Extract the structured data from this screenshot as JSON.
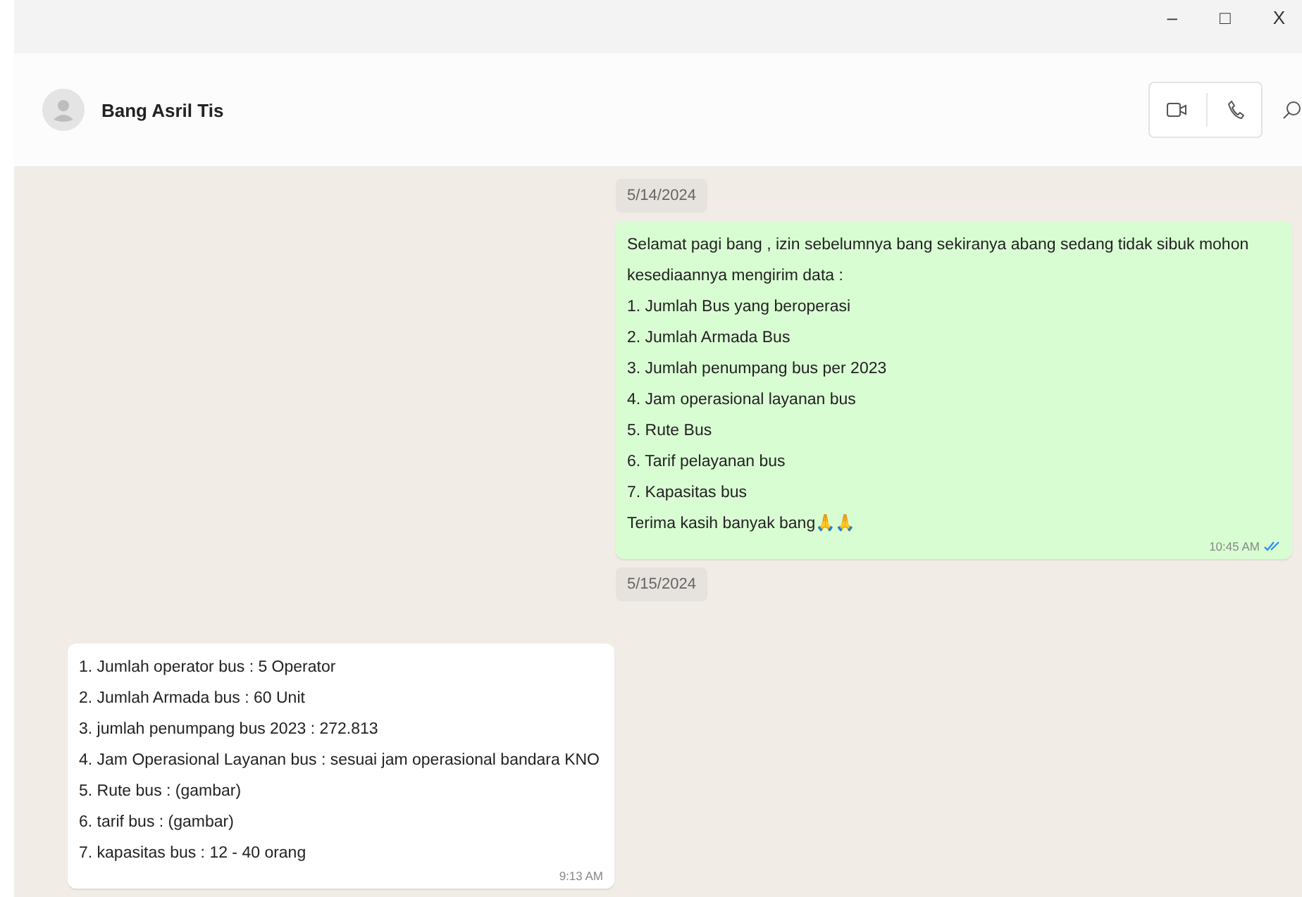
{
  "window": {
    "controls": [
      "–",
      "□",
      "X"
    ]
  },
  "chat": {
    "contact": "Bang Asril Tis"
  },
  "messages": [
    {
      "kind": "date",
      "text": "5/14/2024"
    },
    {
      "kind": "message",
      "outgoing": true,
      "text": "Selamat pagi bang , izin sebelumnya bang sekiranya abang sedang tidak sibuk mohon kesediaannya mengirim data :\n1. Jumlah Bus yang beroperasi\n2. Jumlah Armada Bus\n3. Jumlah penumpang bus per 2023\n4. Jam operasional layanan bus\n5. Rute Bus\n6. Tarif pelayanan bus\n7. Kapasitas bus\nTerima kasih banyak bang🙏🙏",
      "time": "10:45 AM",
      "read": true
    },
    {
      "kind": "date",
      "text": "5/15/2024"
    },
    {
      "kind": "message",
      "outgoing": false,
      "text": "1. Jumlah operator bus : 5 Operator\n2. Jumlah Armada bus : 60 Unit\n3. jumlah penumpang bus 2023 : 272.813\n4. Jam Operasional Layanan bus : sesuai jam operasional bandara KNO\n5. Rute bus : (gambar)\n6. tarif bus : (gambar)\n7. kapasitas bus : 12 - 40 orang",
      "time": "9:13 AM",
      "read": false
    }
  ]
}
